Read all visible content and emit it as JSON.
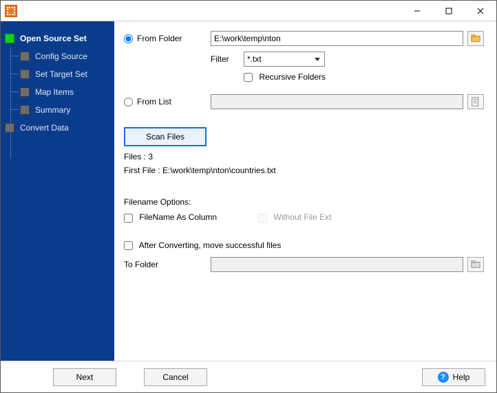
{
  "titlebar": {
    "title": ""
  },
  "sidebar": {
    "items": [
      {
        "label": "Open Source Set",
        "active": true,
        "child": false
      },
      {
        "label": "Config Source",
        "active": false,
        "child": true
      },
      {
        "label": "Set Target Set",
        "active": false,
        "child": true
      },
      {
        "label": "Map Items",
        "active": false,
        "child": true
      },
      {
        "label": "Summary",
        "active": false,
        "child": true
      },
      {
        "label": "Convert Data",
        "active": false,
        "child": false
      }
    ]
  },
  "source": {
    "from_folder_label": "From Folder",
    "folder_path": "E:\\work\\temp\\nton",
    "filter_label": "Filter",
    "filter_value": "*.txt",
    "recursive_label": "Recursive Folders",
    "recursive_checked": false,
    "from_list_label": "From List",
    "selected_radio": "folder"
  },
  "scan": {
    "button": "Scan Files",
    "files_label": "Files : 3",
    "first_file_label": "First File : E:\\work\\temp\\nton\\countries.txt"
  },
  "filename_opts": {
    "section": "Filename Options:",
    "as_column": "FileName As Column",
    "without_ext": "Without File Ext"
  },
  "after": {
    "move_label": "After Converting, move successful files",
    "to_folder_label": "To Folder"
  },
  "footer": {
    "next": "Next",
    "cancel": "Cancel",
    "help": "Help"
  }
}
